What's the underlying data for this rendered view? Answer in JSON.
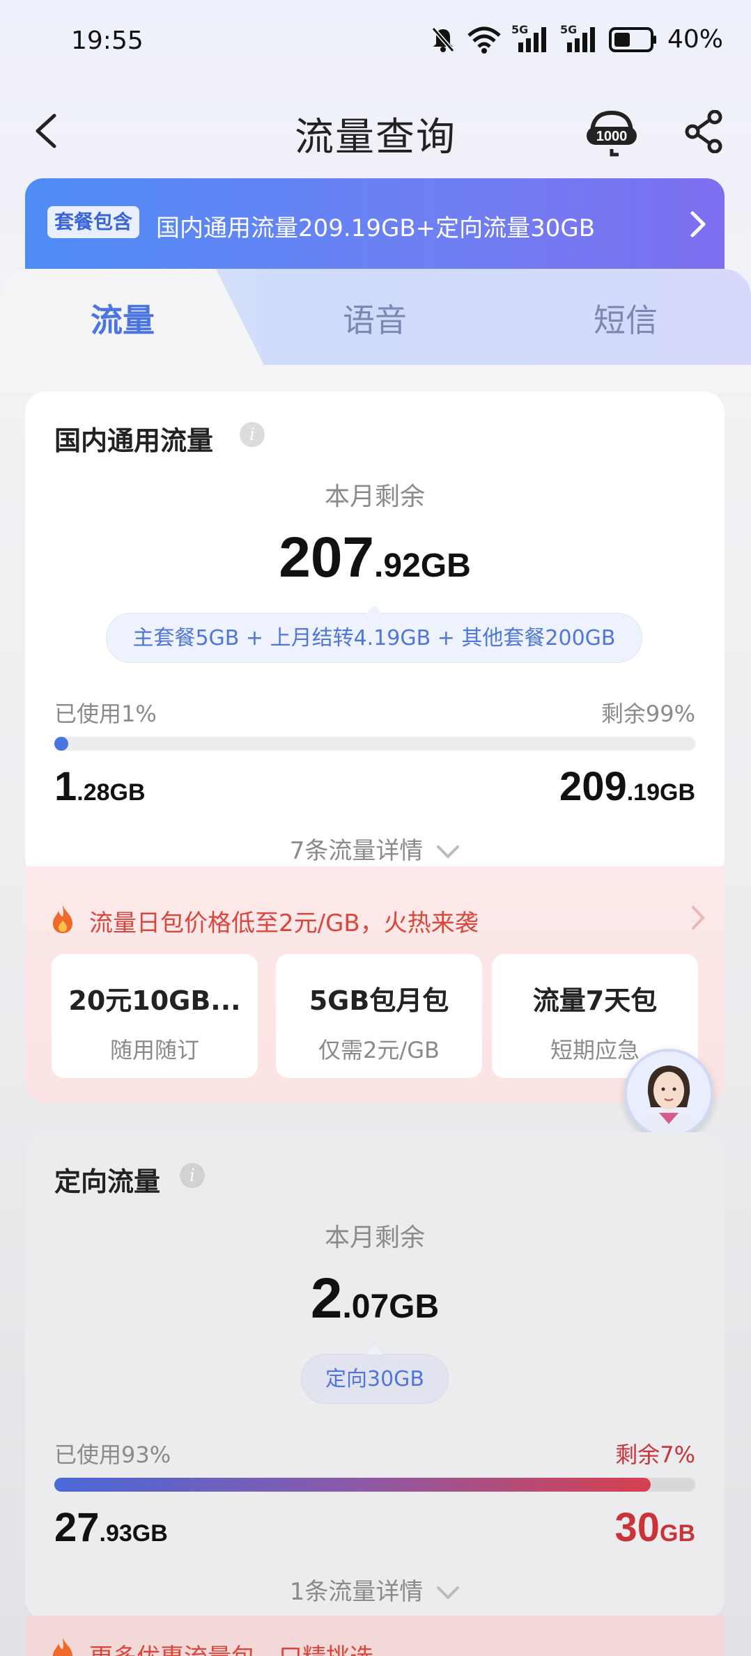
{
  "status_bar": {
    "time": "19:55",
    "network_1": "5G",
    "network_2": "5G",
    "battery": "40%",
    "icons": [
      "bell-muted-icon",
      "wifi-icon",
      "signal-icon",
      "signal-icon",
      "battery-icon"
    ]
  },
  "header": {
    "title": "流量查询",
    "back_icon": "chevron-left-icon",
    "service_icon": "customer-service-icon",
    "service_label": "1000",
    "share_icon": "share-icon"
  },
  "banner": {
    "tag": "套餐包含",
    "text": "国内通用流量209.19GB+定向流量30GB"
  },
  "tabs": [
    {
      "label": "流量",
      "active": true
    },
    {
      "label": "语音",
      "active": false
    },
    {
      "label": "短信",
      "active": false
    }
  ],
  "domestic": {
    "title": "国内通用流量",
    "remain_label": "本月剩余",
    "remain_int": "207",
    "remain_dec": ".92GB",
    "breakdown": "主套餐5GB + 上月结转4.19GB + 其他套餐200GB",
    "used_label": "已使用1%",
    "left_label": "剩余99%",
    "used_pct": 1,
    "used_int": "1",
    "used_dec": ".28GB",
    "total_int": "209",
    "total_dec": ".19GB",
    "detail_link": "7条流量详情"
  },
  "promo": {
    "icon": "fire-icon",
    "text": "流量日包价格低至2元/GB，火热来袭",
    "items": [
      {
        "title": "20元10GB...",
        "sub": "随用随订"
      },
      {
        "title": "5GB包月包",
        "sub": "仅需2元/GB"
      },
      {
        "title": "流量7天包",
        "sub": "短期应急"
      }
    ]
  },
  "directed": {
    "title": "定向流量",
    "remain_label": "本月剩余",
    "remain_int": "2",
    "remain_dec": ".07GB",
    "breakdown": "定向30GB",
    "used_label": "已使用93%",
    "left_label": "剩余7%",
    "used_pct": 93,
    "used_int": "27",
    "used_dec": ".93GB",
    "total_int": "30",
    "total_dec": "GB",
    "detail_link": "1条流量详情"
  },
  "bottom_promo": {
    "text": "更多优惠流量包，口精挑选"
  },
  "colors": {
    "accent_blue": "#4a74e0",
    "warn_red": "#c8343a"
  }
}
